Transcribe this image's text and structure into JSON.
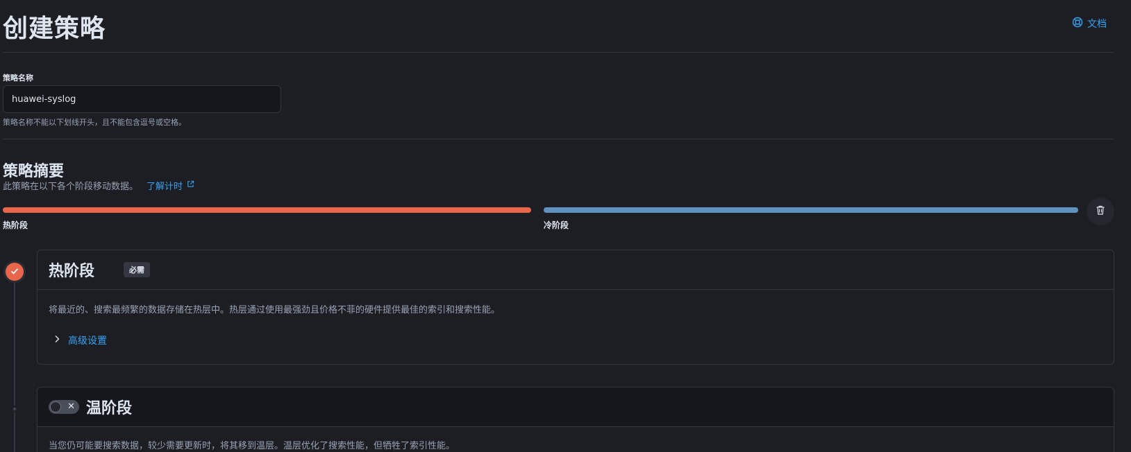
{
  "header": {
    "title": "创建策略",
    "docs_label": "文档"
  },
  "name_field": {
    "label": "策略名称",
    "value": "huawei-syslog",
    "help": "策略名称不能以下划线开头，且不能包含逗号或空格。"
  },
  "summary": {
    "title": "策略摘要",
    "description": "此策略在以下各个阶段移动数据。",
    "learn_link": "了解计时",
    "phases": [
      {
        "label": "热阶段",
        "color": "#e7664c"
      },
      {
        "label": "冷阶段",
        "color": "#6092c0"
      }
    ]
  },
  "hot_phase": {
    "title": "热阶段",
    "badge": "必需",
    "description": "将最近的、搜索最频繁的数据存储在热层中。热层通过使用最强劲且价格不菲的硬件提供最佳的索引和搜索性能。",
    "advanced_label": "高级设置"
  },
  "warm_phase": {
    "title": "温阶段",
    "enabled": false,
    "description": "当您仍可能要搜索数据，较少需要更新时，将其移到温层。温层优化了搜索性能，但牺牲了索引性能。"
  },
  "colors": {
    "accent_link": "#36a2ef",
    "hot": "#e7664c",
    "cold": "#6092c0"
  }
}
